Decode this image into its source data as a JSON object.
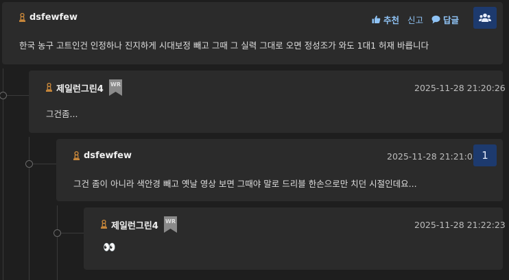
{
  "comments": [
    {
      "author": "dsfewfew",
      "text": "한국 농구 고트인건 인정하나 진지하게 시대보정 빼고 그때 그 실력 그대로 오면 정성조가 와도 1대1 허재 바릅니다",
      "actions": {
        "like": "추천",
        "report": "신고",
        "reply": "답글"
      }
    },
    {
      "author": "제일런그린4",
      "badge": "WR",
      "text": "그건좀...",
      "timestamp": "2025-11-28 21:20:26"
    },
    {
      "author": "dsfewfew",
      "text": "그건 좀이 아니라 색안경 빼고 옛날 영상 보면 그때야 말로 드리블 한손으로만 치던 시절인데요...",
      "timestamp": "2025-11-28 21:21:05",
      "count": "1"
    },
    {
      "author": "제일런그린4",
      "badge": "WR",
      "text": "👀",
      "timestamp": "2025-11-28 21:22:23"
    }
  ],
  "colors": {
    "accent": "#8fc3f5",
    "button": "#1d3a6e",
    "card": "#2b2b2b",
    "background": "#1e1e1e"
  },
  "icons": {
    "rank": "rank-pawn-icon",
    "like": "thumbs-up-icon",
    "reply": "speech-bubble-icon",
    "group": "users-icon"
  }
}
